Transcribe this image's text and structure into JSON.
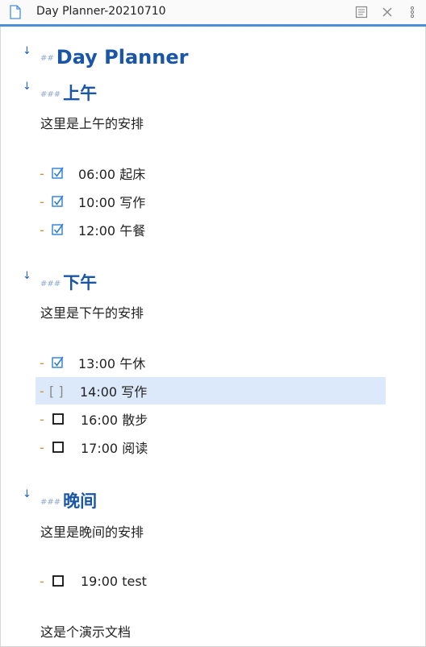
{
  "titlebar": {
    "title": "Day Planner-20210710",
    "icons": [
      "document-icon",
      "reader-mode-icon",
      "close-icon",
      "more-options-icon"
    ]
  },
  "doc": {
    "h2": {
      "marker": "##",
      "text": "Day Planner"
    },
    "morning": {
      "marker": "###",
      "title": "上午",
      "desc": "这里是上午的安排",
      "tasks": [
        {
          "time": "06:00 起床",
          "checked": true
        },
        {
          "time": "10:00 写作",
          "checked": true
        },
        {
          "time": "12:00 午餐",
          "checked": true
        }
      ]
    },
    "afternoon": {
      "marker": "###",
      "title": "下午",
      "desc": "这里是下午的安排",
      "tasks": [
        {
          "time": "13:00 午休",
          "checked": true
        },
        {
          "time": "14:00 写作",
          "checked": false,
          "raw_box": "[ ]"
        },
        {
          "time": "16:00 散步",
          "checked": false
        },
        {
          "time": "17:00 阅读",
          "checked": false
        }
      ]
    },
    "evening": {
      "marker": "###",
      "title": "晚间",
      "desc": "这里是晚间的安排",
      "tasks": [
        {
          "time": "19:00 test",
          "checked": false
        }
      ]
    },
    "footer": "这是个演示文档",
    "list_dash": "-"
  },
  "colors": {
    "heading": "#1a56a8",
    "accent_bar": "#4a8fd8",
    "dash": "#d08a3a",
    "active_row": "#dce9fb"
  }
}
